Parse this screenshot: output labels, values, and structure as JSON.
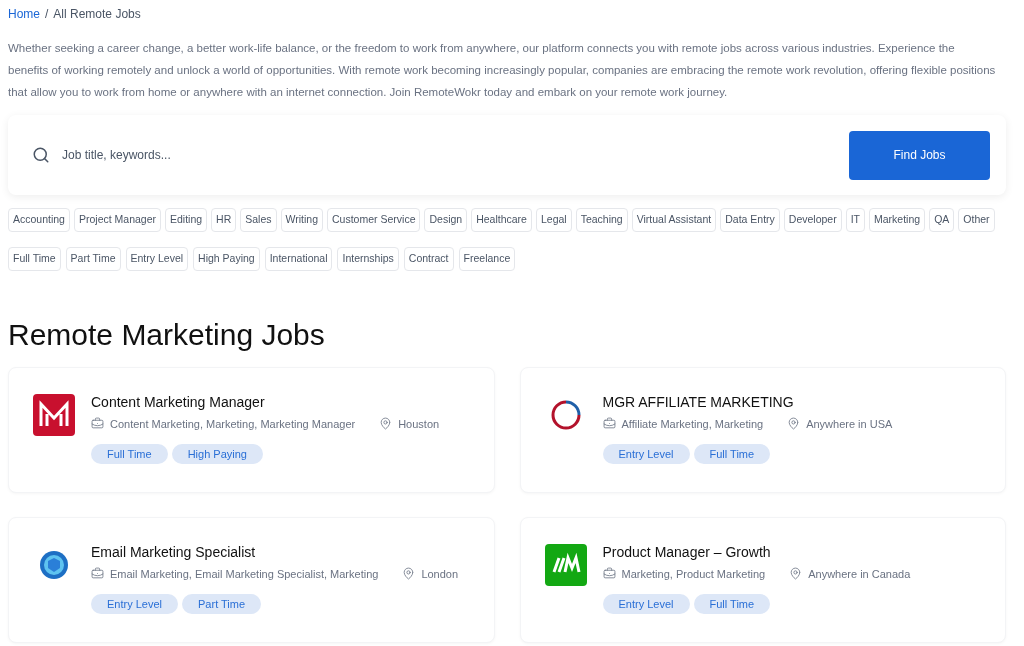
{
  "breadcrumb": {
    "home": "Home",
    "separator": "/",
    "current": "All Remote Jobs"
  },
  "intro": "Whether seeking a career change, a better work-life balance, or the freedom to work from anywhere, our platform connects you with remote jobs across various industries. Experience the benefits of working remotely and unlock a world of opportunities. With remote work becoming increasingly popular, companies are embracing the remote work revolution, offering flexible positions that allow you to work from home or anywhere with an internet connection. Join RemoteWokr today and embark on your remote work journey.",
  "search": {
    "placeholder": "Job title, keywords...",
    "button": "Find Jobs"
  },
  "categories": [
    "Accounting",
    "Project Manager",
    "Editing",
    "HR",
    "Sales",
    "Writing",
    "Customer Service",
    "Design",
    "Healthcare",
    "Legal",
    "Teaching",
    "Virtual Assistant",
    "Data Entry",
    "Developer",
    "IT",
    "Marketing",
    "QA",
    "Other"
  ],
  "job_types": [
    "Full Time",
    "Part Time",
    "Entry Level",
    "High Paying",
    "International",
    "Internships",
    "Contract",
    "Freelance"
  ],
  "heading": "Remote Marketing Jobs",
  "jobs": [
    {
      "title": "Content Marketing Manager",
      "kind": "red-m",
      "tags_text": "Content Marketing, Marketing, Marketing Manager",
      "location": "Houston",
      "badges": [
        "Full Time",
        "High Paying"
      ]
    },
    {
      "title": "MGR AFFILIATE MARKETING",
      "kind": "ring",
      "tags_text": "Affiliate Marketing, Marketing",
      "location": "Anywhere in USA",
      "badges": [
        "Entry Level",
        "Full Time"
      ]
    },
    {
      "title": "Email Marketing Specialist",
      "kind": "cube",
      "tags_text": "Email Marketing, Email Marketing Specialist, Marketing",
      "location": "London",
      "badges": [
        "Entry Level",
        "Part Time"
      ]
    },
    {
      "title": "Product Manager – Growth",
      "kind": "green-m",
      "tags_text": "Marketing, Product Marketing",
      "location": "Anywhere in Canada",
      "badges": [
        "Entry Level",
        "Full Time"
      ]
    }
  ]
}
